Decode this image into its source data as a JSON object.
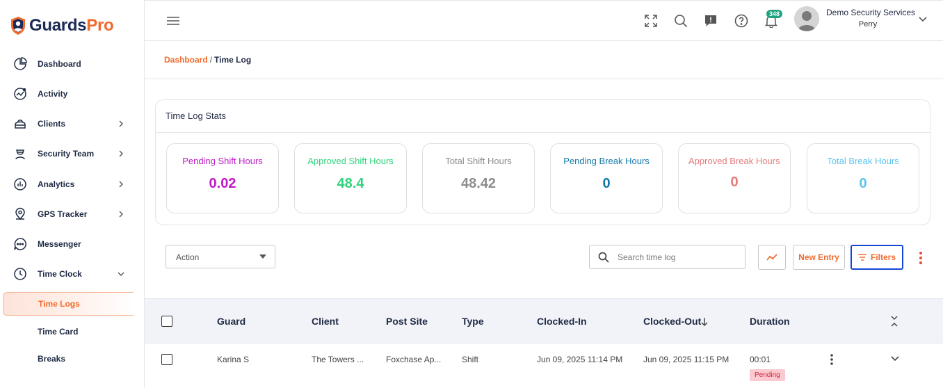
{
  "brand": {
    "name_part1": "Guards",
    "name_part2": "Pro",
    "accent": "#f26a2e",
    "navy": "#1c2a55"
  },
  "sidebar": {
    "items": [
      {
        "label": "Dashboard",
        "icon": "pie-chart-icon"
      },
      {
        "label": "Activity",
        "icon": "activity-icon"
      },
      {
        "label": "Clients",
        "icon": "clients-icon",
        "has_children": true
      },
      {
        "label": "Security Team",
        "icon": "guard-icon",
        "has_children": true
      },
      {
        "label": "Analytics",
        "icon": "analytics-icon",
        "has_children": true
      },
      {
        "label": "GPS Tracker",
        "icon": "location-pin-icon",
        "has_children": true
      },
      {
        "label": "Messenger",
        "icon": "chat-icon"
      },
      {
        "label": "Time Clock",
        "icon": "clock-icon",
        "expanded": true
      }
    ],
    "sub_items": [
      {
        "label": "Time Logs",
        "active": true
      },
      {
        "label": "Time Card"
      },
      {
        "label": "Breaks"
      }
    ]
  },
  "topbar": {
    "notification_count": "348",
    "user_org": "Demo Security Services",
    "user_name": "Perry"
  },
  "breadcrumb": {
    "parent": "Dashboard",
    "separator": "/",
    "current": "Time Log"
  },
  "stats": {
    "title": "Time Log Stats",
    "cards": [
      {
        "label": "Pending Shift Hours",
        "value": "0.02",
        "color": "#c21bc8"
      },
      {
        "label": "Approved Shift Hours",
        "value": "48.4",
        "color": "#2fd37c"
      },
      {
        "label": "Total Shift Hours",
        "value": "48.42",
        "color": "#8d8d8d"
      },
      {
        "label": "Pending Break Hours",
        "value": "0",
        "color": "#1379a8"
      },
      {
        "label": "Approved Break Hours",
        "value": "0",
        "color": "#e6797a"
      },
      {
        "label": "Total Break Hours",
        "value": "0",
        "color": "#5bc3ef"
      }
    ]
  },
  "toolbar": {
    "action_label": "Action",
    "search_placeholder": "Search time log",
    "new_entry_label": "New Entry",
    "filters_label": "Filters"
  },
  "table": {
    "columns": [
      "Guard",
      "Client",
      "Post Site",
      "Type",
      "Clocked-In",
      "Clocked-Out",
      "Duration"
    ],
    "rows": [
      {
        "guard": "Karina S",
        "client": "The Towers ...",
        "post_site": "Foxchase Ap...",
        "type": "Shift",
        "clocked_in": "Jun 09, 2025 11:14 PM",
        "clocked_out": "Jun 09, 2025 11:15 PM",
        "duration": "00:01",
        "status": "Pending"
      }
    ]
  }
}
